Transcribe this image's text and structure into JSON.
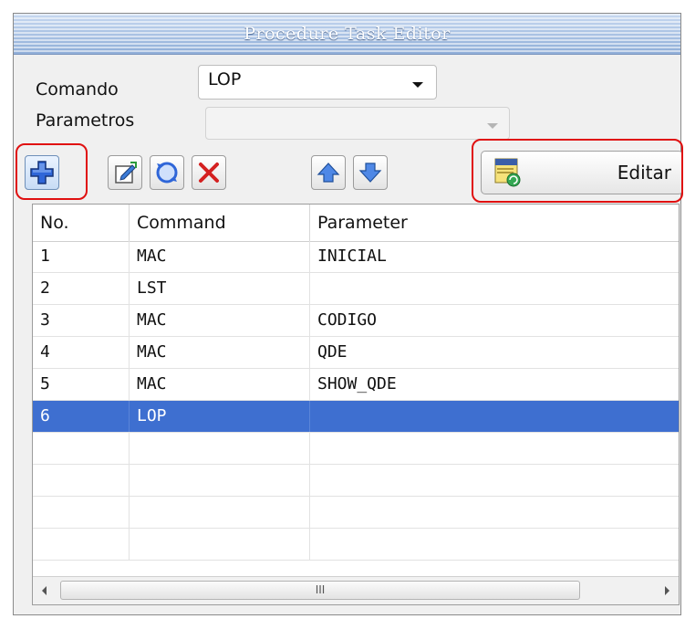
{
  "window": {
    "title": "Procedure Task Editor"
  },
  "form": {
    "comando_label": "Comando",
    "comando_value": "LOP",
    "parametros_label": "Parametros",
    "parametros_value": ""
  },
  "toolbar": {
    "buttons": [
      {
        "name": "add-button",
        "icon": "plus-icon"
      },
      {
        "name": "edit-button",
        "icon": "edit-icon"
      },
      {
        "name": "refresh-button",
        "icon": "refresh-icon"
      },
      {
        "name": "delete-button",
        "icon": "delete-icon"
      },
      {
        "name": "move-up-button",
        "icon": "arrow-up-icon"
      },
      {
        "name": "move-down-button",
        "icon": "arrow-down-icon"
      }
    ],
    "editar_label": "Editar",
    "editar_icon": "database-icon"
  },
  "table": {
    "columns": [
      "No.",
      "Command",
      "Parameter"
    ],
    "rows": [
      {
        "no": "1",
        "command": "MAC",
        "parameter": "INICIAL"
      },
      {
        "no": "2",
        "command": "LST",
        "parameter": ""
      },
      {
        "no": "3",
        "command": "MAC",
        "parameter": "CODIGO"
      },
      {
        "no": "4",
        "command": "MAC",
        "parameter": "QDE"
      },
      {
        "no": "5",
        "command": "MAC",
        "parameter": "SHOW_QDE"
      },
      {
        "no": "6",
        "command": "LOP",
        "parameter": ""
      }
    ],
    "selected_row": 6,
    "scroll_grip": "III"
  },
  "colors": {
    "selection": "#3e6fd0",
    "highlight_outline": "#e01010"
  }
}
